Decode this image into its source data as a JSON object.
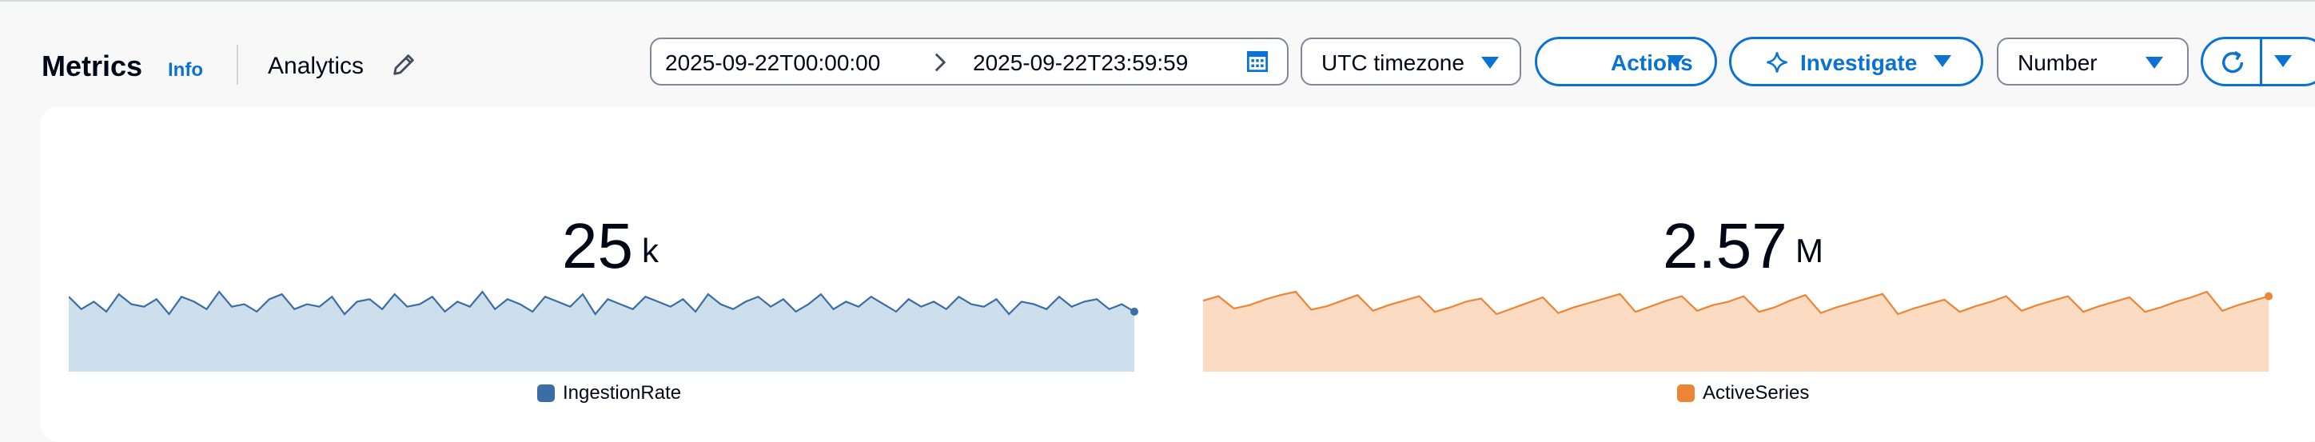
{
  "header": {
    "title": "Metrics",
    "info_label": "Info",
    "dashboard_name": "Analytics"
  },
  "toolbar": {
    "date_start": "2025-09-22T00:00:00",
    "date_end": "2025-09-22T23:59:59",
    "timezone": "UTC timezone",
    "actions_label": "Actions",
    "investigate_label": "Investigate",
    "view_type": "Number"
  },
  "colors": {
    "accent": "#0972d3",
    "ingestion_line": "#3a6ea5",
    "ingestion_fill": "#cddfec",
    "active_line": "#ec8535",
    "active_fill": "#fbdcc3"
  },
  "icons": [
    "edit-icon",
    "calendar-icon",
    "chevron-right-icon",
    "sparkle-icon",
    "refresh-icon",
    "caret-down-icon"
  ],
  "metrics": [
    {
      "value": "25",
      "unit": "k",
      "legend": "IngestionRate"
    },
    {
      "value": "2.57",
      "unit": "M",
      "legend": "ActiveSeries"
    }
  ],
  "chart_data": [
    {
      "type": "area",
      "series": [
        {
          "name": "IngestionRate",
          "values": [
            25.3,
            24.8,
            25.1,
            24.7,
            25.4,
            25.0,
            24.9,
            25.2,
            24.6,
            25.3,
            25.1,
            24.8,
            25.5,
            24.9,
            25.0,
            24.7,
            25.2,
            25.4,
            24.8,
            25.0,
            24.9,
            25.3,
            24.6,
            25.1,
            25.2,
            24.8,
            25.4,
            24.9,
            25.0,
            25.3,
            24.7,
            25.1,
            24.9,
            25.5,
            24.8,
            25.2,
            25.0,
            24.7,
            25.3,
            25.1,
            24.9,
            25.4,
            24.6,
            25.2,
            25.0,
            24.8,
            25.3,
            25.1,
            24.9,
            25.2,
            24.7,
            25.4,
            25.0,
            24.8,
            25.1,
            25.3,
            24.9,
            25.2,
            24.7,
            25.0,
            25.4,
            24.8,
            25.1,
            24.9,
            25.3,
            25.0,
            24.7,
            25.2,
            24.9,
            25.1,
            24.8,
            25.3,
            25.0,
            24.9,
            25.2,
            24.6,
            25.1,
            25.0,
            24.8,
            25.3,
            24.9,
            25.1,
            25.2,
            24.8,
            25.0,
            24.7
          ]
        }
      ]
    },
    {
      "type": "area",
      "series": [
        {
          "name": "ActiveSeries",
          "values": [
            2.62,
            2.66,
            2.55,
            2.58,
            2.63,
            2.67,
            2.7,
            2.54,
            2.57,
            2.62,
            2.67,
            2.53,
            2.58,
            2.62,
            2.66,
            2.52,
            2.56,
            2.61,
            2.64,
            2.5,
            2.55,
            2.6,
            2.65,
            2.51,
            2.56,
            2.6,
            2.64,
            2.68,
            2.52,
            2.57,
            2.62,
            2.66,
            2.53,
            2.58,
            2.61,
            2.66,
            2.52,
            2.56,
            2.62,
            2.67,
            2.51,
            2.56,
            2.6,
            2.64,
            2.68,
            2.5,
            2.55,
            2.59,
            2.63,
            2.52,
            2.57,
            2.61,
            2.66,
            2.53,
            2.58,
            2.62,
            2.66,
            2.52,
            2.57,
            2.61,
            2.65,
            2.52,
            2.56,
            2.61,
            2.65,
            2.7,
            2.53,
            2.58,
            2.62,
            2.66
          ]
        }
      ]
    }
  ]
}
